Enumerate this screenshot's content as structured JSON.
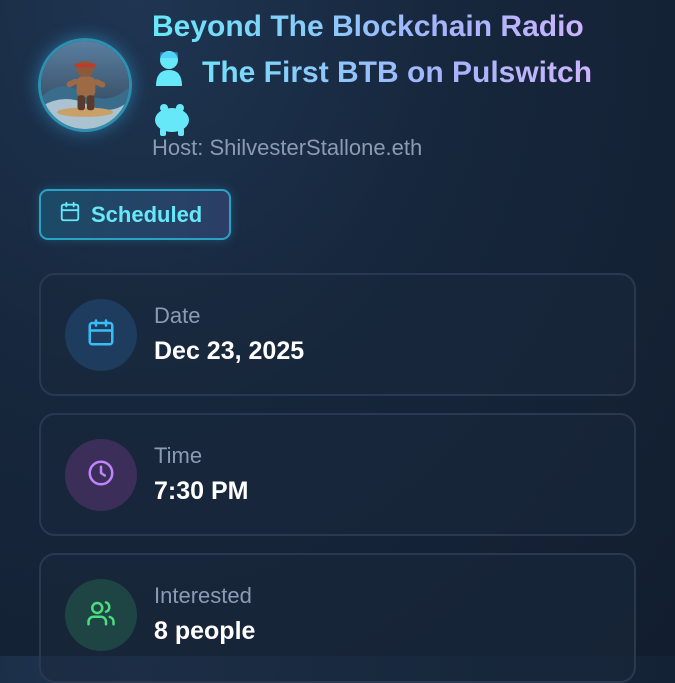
{
  "event": {
    "title_line1": "Beyond The Blockchain Radio",
    "title_line2": "The First BTB on Pulswitch",
    "host": "Host: ShilvesterStallone.eth",
    "emojis": [
      "bust-in-silhouette-icon",
      "hippo-icon"
    ]
  },
  "status": {
    "label": "Scheduled",
    "icon": "calendar-icon"
  },
  "details": [
    {
      "label": "Date",
      "value": "Dec 23, 2025",
      "icon": "calendar-icon"
    },
    {
      "label": "Time",
      "value": "7:30 PM",
      "icon": "clock-icon"
    },
    {
      "label": "Interested",
      "value": "8 people",
      "icon": "users-icon"
    }
  ],
  "colors": {
    "accent_cyan": "#67e8f9",
    "accent_purple": "#d8b4fe",
    "date_icon": "#38bdf8",
    "time_icon": "#c084fc",
    "interested_icon": "#4ade80"
  }
}
